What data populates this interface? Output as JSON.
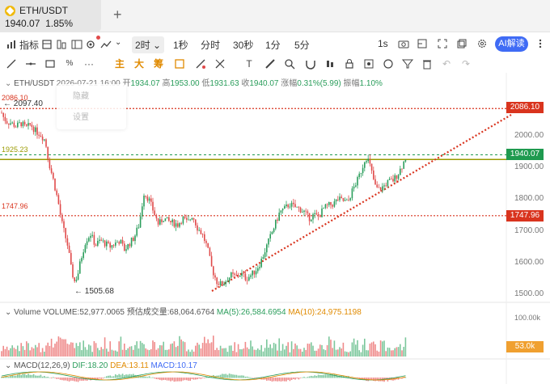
{
  "tab": {
    "symbol": "ETH/USDT",
    "price": "1940.07",
    "change": "1.85%",
    "add": "+"
  },
  "toolbar1": {
    "indicators": "指标",
    "interval_selected": "2时",
    "intervals": [
      "1秒",
      "分时",
      "30秒",
      "1分",
      "5分"
    ],
    "interval_right": "1s",
    "ai": "AI解读"
  },
  "toolbar2": {
    "zhu": "主",
    "da": "大",
    "chou": "筹"
  },
  "ohlc": {
    "pair": "ETH/USDT",
    "time": "2026-07-21 16:00",
    "open_label": "开",
    "open": "1934.07",
    "high_label": "高",
    "high": "1953.00",
    "low_label": "低",
    "low": "1931.63",
    "close_label": "收",
    "close": "1940.07",
    "change_label": "涨幅",
    "change": "0.31%(5.99)",
    "amp_label": "振幅",
    "amp": "1.10%"
  },
  "popup": {
    "hide": "隐藏",
    "settings": "设置"
  },
  "levels": {
    "l2086": "2086.10",
    "l1925": "1925.23",
    "l1747": "1747.96",
    "last": "1940.07",
    "high_mark": "2097.40",
    "low_mark": "1505.68"
  },
  "yaxis": [
    "2000.00",
    "1900.00",
    "1800.00",
    "1700.00",
    "1600.00",
    "1500.00"
  ],
  "volume": {
    "label": "Volume",
    "vol_label": "VOLUME:",
    "vol": "52,977.0065",
    "pred_label": "预估成交量:",
    "pred": "68,064.6764",
    "ma5_label": "MA(5):",
    "ma5": "26,584.6954",
    "ma10_label": "MA(10):",
    "ma10": "24,975.1198",
    "axis": [
      "100.00k"
    ],
    "current": "53.0k"
  },
  "macd": {
    "label": "MACD(12,26,9)",
    "dif_label": "DIF:",
    "dif": "18.20",
    "dea_label": "DEA:",
    "dea": "13.11",
    "macd_label": "MACD:",
    "macd": "10.17"
  },
  "colors": {
    "up": "#2a9d5b",
    "down": "#e04a4a",
    "accent": "#3f6bf5",
    "badge_red": "#d9341e",
    "badge_green": "#1f9a4f",
    "badge_orange": "#f0a030"
  },
  "chart_data": {
    "type": "candlestick",
    "symbol": "ETH/USDT",
    "interval": "2h",
    "ylim": [
      1460,
      2140
    ],
    "close_path": [
      [
        0,
        2085
      ],
      [
        4,
        2060
      ],
      [
        8,
        2045
      ],
      [
        14,
        2040
      ],
      [
        20,
        2030
      ],
      [
        26,
        2040
      ],
      [
        32,
        2025
      ],
      [
        38,
        2035
      ],
      [
        44,
        2015
      ],
      [
        50,
        2005
      ],
      [
        56,
        1985
      ],
      [
        60,
        1920
      ],
      [
        66,
        1860
      ],
      [
        72,
        1790
      ],
      [
        76,
        1730
      ],
      [
        80,
        1690
      ],
      [
        84,
        1650
      ],
      [
        88,
        1580
      ],
      [
        92,
        1540
      ],
      [
        96,
        1560
      ],
      [
        100,
        1610
      ],
      [
        106,
        1670
      ],
      [
        112,
        1690
      ],
      [
        118,
        1655
      ],
      [
        124,
        1670
      ],
      [
        130,
        1660
      ],
      [
        136,
        1650
      ],
      [
        142,
        1660
      ],
      [
        148,
        1670
      ],
      [
        154,
        1640
      ],
      [
        160,
        1660
      ],
      [
        166,
        1680
      ],
      [
        172,
        1720
      ],
      [
        178,
        1820
      ],
      [
        184,
        1800
      ],
      [
        190,
        1760
      ],
      [
        196,
        1720
      ],
      [
        202,
        1740
      ],
      [
        208,
        1730
      ],
      [
        214,
        1725
      ],
      [
        220,
        1720
      ],
      [
        226,
        1740
      ],
      [
        232,
        1725
      ],
      [
        238,
        1750
      ],
      [
        244,
        1710
      ],
      [
        250,
        1690
      ],
      [
        256,
        1650
      ],
      [
        262,
        1580
      ],
      [
        268,
        1540
      ],
      [
        274,
        1530
      ],
      [
        280,
        1545
      ],
      [
        286,
        1560
      ],
      [
        292,
        1555
      ],
      [
        298,
        1565
      ],
      [
        304,
        1550
      ],
      [
        310,
        1560
      ],
      [
        316,
        1575
      ],
      [
        322,
        1600
      ],
      [
        328,
        1640
      ],
      [
        334,
        1680
      ],
      [
        340,
        1720
      ],
      [
        346,
        1760
      ],
      [
        352,
        1770
      ],
      [
        358,
        1785
      ],
      [
        364,
        1775
      ],
      [
        370,
        1770
      ],
      [
        376,
        1760
      ],
      [
        382,
        1740
      ],
      [
        388,
        1750
      ],
      [
        394,
        1745
      ],
      [
        400,
        1770
      ],
      [
        406,
        1780
      ],
      [
        412,
        1785
      ],
      [
        418,
        1800
      ],
      [
        424,
        1795
      ],
      [
        430,
        1790
      ],
      [
        436,
        1830
      ],
      [
        442,
        1860
      ],
      [
        448,
        1900
      ],
      [
        452,
        1935
      ],
      [
        456,
        1920
      ],
      [
        460,
        1880
      ],
      [
        464,
        1840
      ],
      [
        468,
        1830
      ],
      [
        474,
        1840
      ],
      [
        480,
        1855
      ],
      [
        486,
        1860
      ],
      [
        492,
        1880
      ],
      [
        498,
        1910
      ],
      [
        503,
        1940
      ]
    ]
  }
}
